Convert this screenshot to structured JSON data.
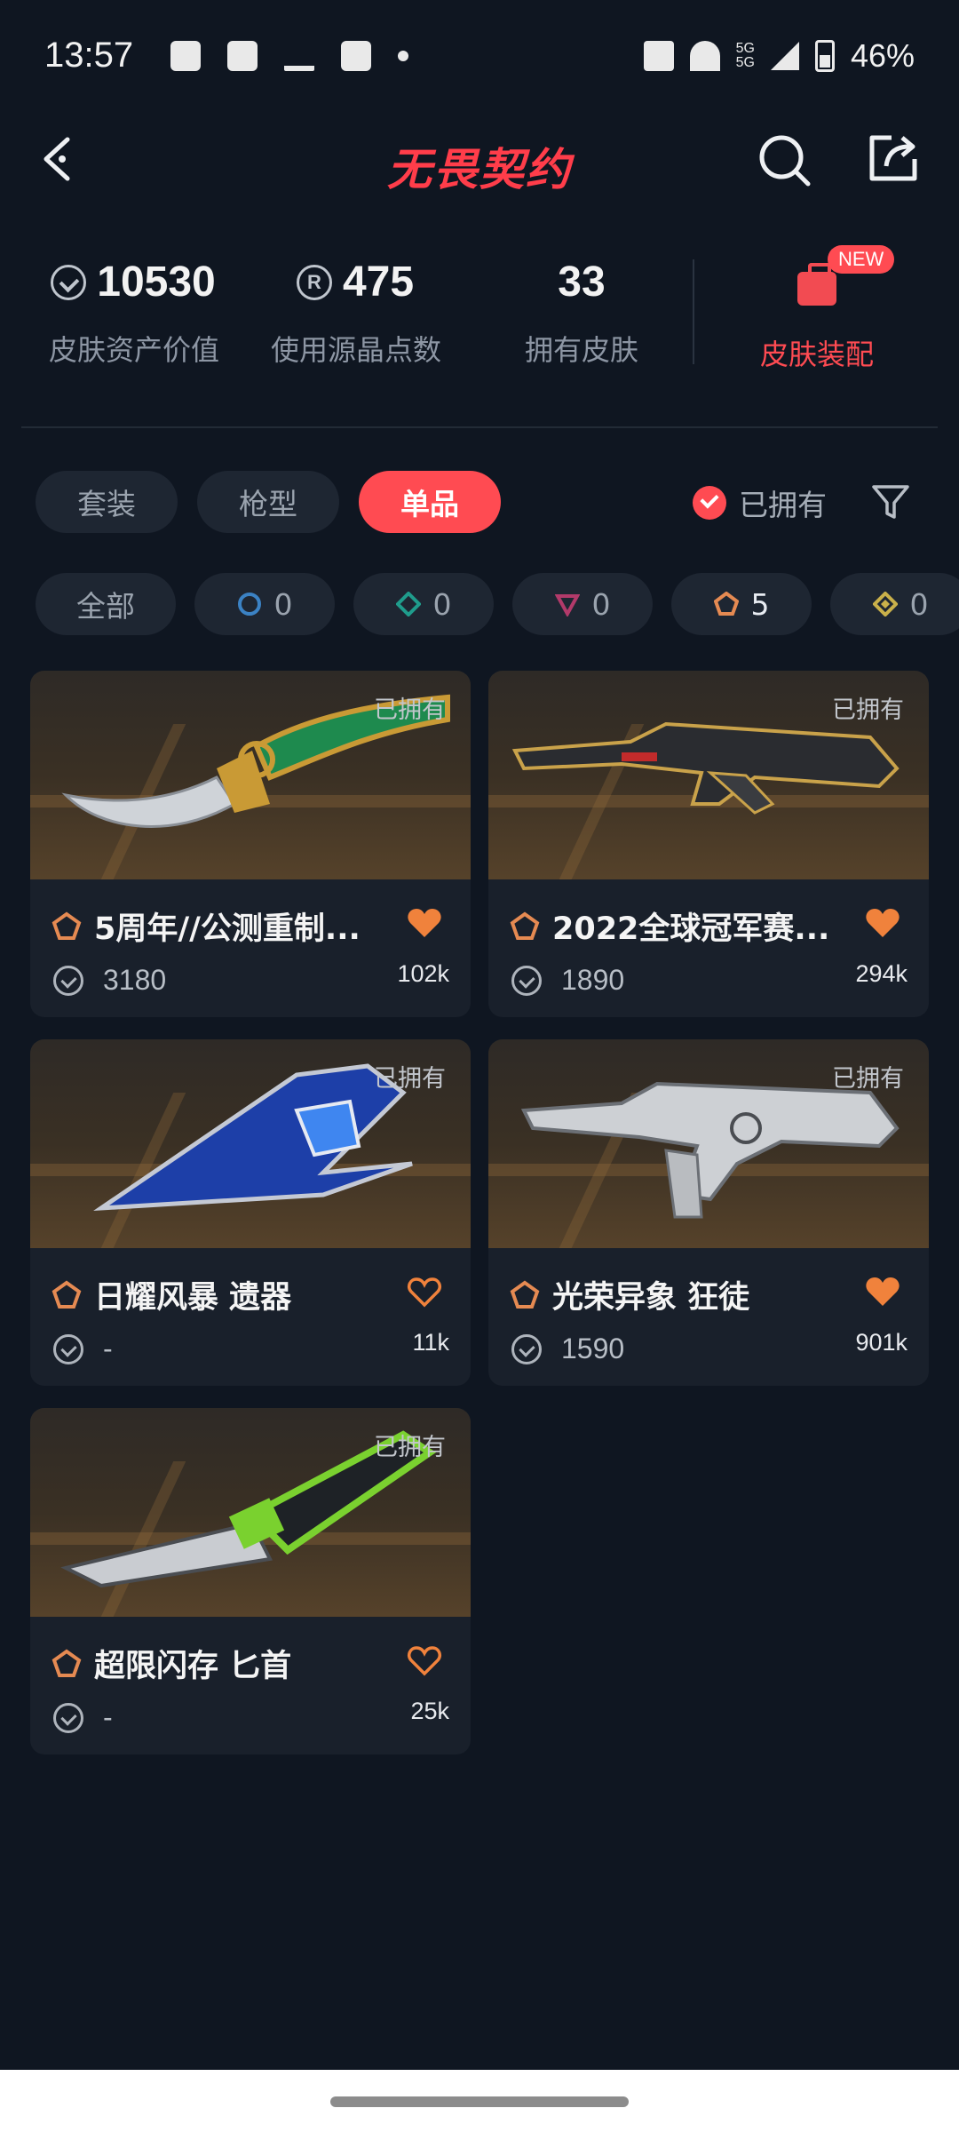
{
  "status_bar": {
    "time": "13:57",
    "network_1": "5G",
    "network_2": "5G",
    "battery": "46%"
  },
  "header": {
    "title": "无畏契约",
    "back_icon": "back-arrow-icon",
    "search_icon": "search-icon",
    "share_icon": "share-icon"
  },
  "stats": {
    "asset_value": "10530",
    "asset_label": "皮肤资产价值",
    "radianite_points": "475",
    "radianite_label": "使用源晶点数",
    "skins_owned": "33",
    "skins_owned_label": "拥有皮肤",
    "loadout_badge": "NEW",
    "loadout_label": "皮肤装配"
  },
  "tabs": [
    {
      "label": "套装",
      "active": false
    },
    {
      "label": "枪型",
      "active": false
    },
    {
      "label": "单品",
      "active": true
    }
  ],
  "owned_filter": {
    "label": "已拥有",
    "checked": true
  },
  "tiers": [
    {
      "label": "全部"
    },
    {
      "count": "0",
      "color": "#3b82c4"
    },
    {
      "count": "0",
      "color": "#1f9c8c"
    },
    {
      "count": "0",
      "color": "#b23a6a"
    },
    {
      "count": "5",
      "color": "#e58a52"
    },
    {
      "count": "0",
      "color": "#c9b04a"
    }
  ],
  "cards": [
    {
      "name": "5周年//公测重制...",
      "owned": "已拥有",
      "price": "3180",
      "likes": "102k",
      "liked": true
    },
    {
      "name": "2022全球冠军赛...",
      "owned": "已拥有",
      "price": "1890",
      "likes": "294k",
      "liked": true
    },
    {
      "name": "日耀风暴 遗器",
      "owned": "已拥有",
      "price": "-",
      "likes": "11k",
      "liked": false
    },
    {
      "name": "光荣异象 狂徒",
      "owned": "已拥有",
      "price": "1590",
      "likes": "901k",
      "liked": true
    },
    {
      "name": "超限闪存 匕首",
      "owned": "已拥有",
      "price": "-",
      "likes": "25k",
      "liked": false
    }
  ],
  "colors": {
    "accent": "#ff4b52",
    "background": "#0f1621",
    "card": "#19202b",
    "heart": "#f0823c"
  }
}
